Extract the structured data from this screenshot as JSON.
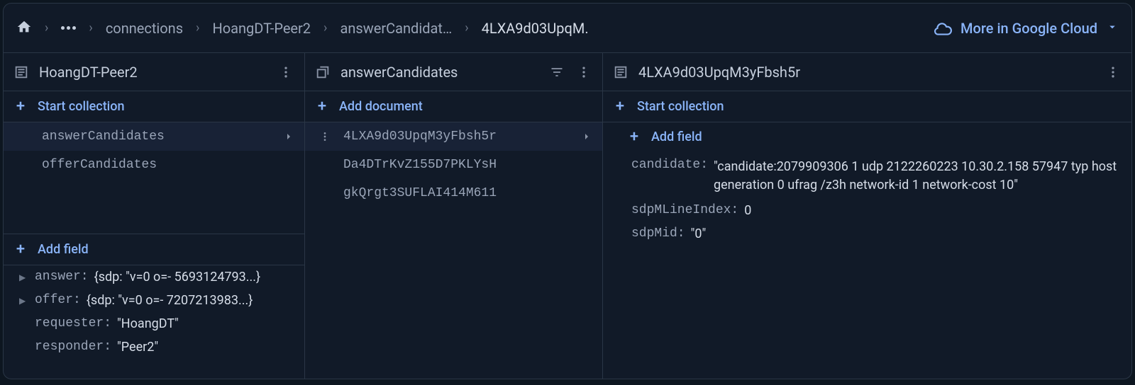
{
  "breadcrumb": {
    "items": [
      "connections",
      "HoangDT-Peer2",
      "answerCandidat…",
      "4LXA9d03UpqM."
    ]
  },
  "cloud_link": "More in Google Cloud",
  "col1": {
    "title": "HoangDT-Peer2",
    "start_collection": "Start collection",
    "collections": [
      "answerCandidates",
      "offerCandidates"
    ],
    "selected": 0,
    "add_field": "Add field",
    "fields": {
      "answer": {
        "key": "answer:",
        "val": "{sdp: \"v=0 o=- 5693124793...}"
      },
      "offer": {
        "key": "offer:",
        "val": "{sdp: \"v=0 o=- 7207213983...}"
      },
      "requester": {
        "key": "requester:",
        "val": "\"HoangDT\""
      },
      "responder": {
        "key": "responder:",
        "val": "\"Peer2\""
      }
    }
  },
  "col2": {
    "title": "answerCandidates",
    "add_document": "Add document",
    "docs": [
      "4LXA9d03UpqM3yFbsh5r",
      "Da4DTrKvZ155D7PKLYsH",
      "gkQrgt3SUFLAI414M611"
    ],
    "selected": 0
  },
  "col3": {
    "title": "4LXA9d03UpqM3yFbsh5r",
    "start_collection": "Start collection",
    "add_field": "Add field",
    "fields": {
      "candidate": {
        "key": "candidate:",
        "val": "\"candidate:2079909306 1 udp 2122260223 10.30.2.158 57947 typ host generation 0 ufrag /z3h network-id 1 network-cost 10\""
      },
      "sdpMLineIndex": {
        "key": "sdpMLineIndex:",
        "val": "0"
      },
      "sdpMid": {
        "key": "sdpMid:",
        "val": "\"0\""
      }
    }
  }
}
